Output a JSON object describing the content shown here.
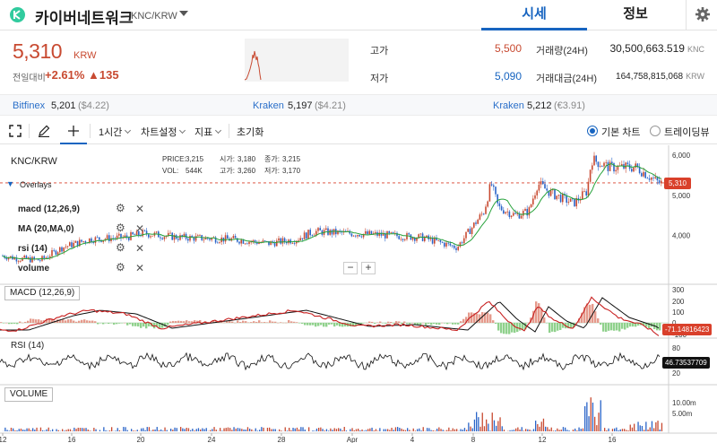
{
  "header": {
    "title": "카이버네트워크",
    "pair": "KNC/KRW",
    "tabs": [
      {
        "label": "시세",
        "active": true
      },
      {
        "label": "정보",
        "active": false
      }
    ]
  },
  "summary": {
    "price": "5,310",
    "unit": "KRW",
    "change_label": "전일대비",
    "change_pct": "+2.61%",
    "change_abs": "▲135",
    "high_label": "고가",
    "high": "5,500",
    "low_label": "저가",
    "low": "5,090",
    "volume_label": "거래량(24H)",
    "volume": "30,500,663.519",
    "volume_unit": "KNC",
    "amount_label": "거래대금(24H)",
    "amount": "164,758,815,068",
    "amount_unit": "KRW"
  },
  "exchanges": [
    {
      "name": "Bitfinex",
      "price": "5,201",
      "usd": "($4.22)"
    },
    {
      "name": "Kraken",
      "price": "5,197",
      "usd": "($4.21)"
    },
    {
      "name": "Kraken",
      "price": "5,212",
      "usd": "(€3.91)"
    }
  ],
  "toolbar": {
    "interval": "1시간",
    "chart_settings": "차트설정",
    "indicators": "지표",
    "reset": "초기화",
    "basic_chart": "기본 차트",
    "tradingview": "트레이딩뷰"
  },
  "chart": {
    "symbol": "KNC/KRW",
    "overlays_label": "Overlays",
    "ohlc": {
      "price_label": "PRICE:",
      "price": "3,215",
      "open_label": "시가:",
      "open": "3,180",
      "close_label": "종가:",
      "close": "3,215",
      "vol_label": "VOL:",
      "vol": "544K",
      "high_label": "고가:",
      "high": "3,260",
      "low_label": "저가:",
      "low": "3,170"
    },
    "overlays": [
      {
        "name": "macd (12,26,9)"
      },
      {
        "name": "MA (20,MA,0)"
      },
      {
        "name": "rsi (14)"
      },
      {
        "name": "volume"
      }
    ],
    "current_price_tag": "5,310",
    "macd_label": "MACD (12,26,9)",
    "macd_value": "-71.14816423",
    "rsi_label": "RSI (14)",
    "rsi_value": "46.73537709",
    "volume_label": "VOLUME",
    "price_axis": [
      "6,000",
      "5,000",
      "4,000"
    ],
    "macd_axis": [
      "300",
      "200",
      "100",
      "0",
      "-100"
    ],
    "rsi_axis": [
      "80",
      "20"
    ],
    "volume_axis": [
      "10.00m",
      "5.00m"
    ],
    "x_axis": [
      "12",
      "16",
      "20",
      "24",
      "28",
      "Apr",
      "4",
      "8",
      "12",
      "16"
    ],
    "zoom_out": "−",
    "zoom_in": "+",
    "colors": {
      "candle_up": "#c84a31",
      "candle_down": "#2a64c8",
      "ma": "#26a23a",
      "macd": "#c82020",
      "signal": "#111111",
      "accent": "#1764c0"
    }
  }
}
